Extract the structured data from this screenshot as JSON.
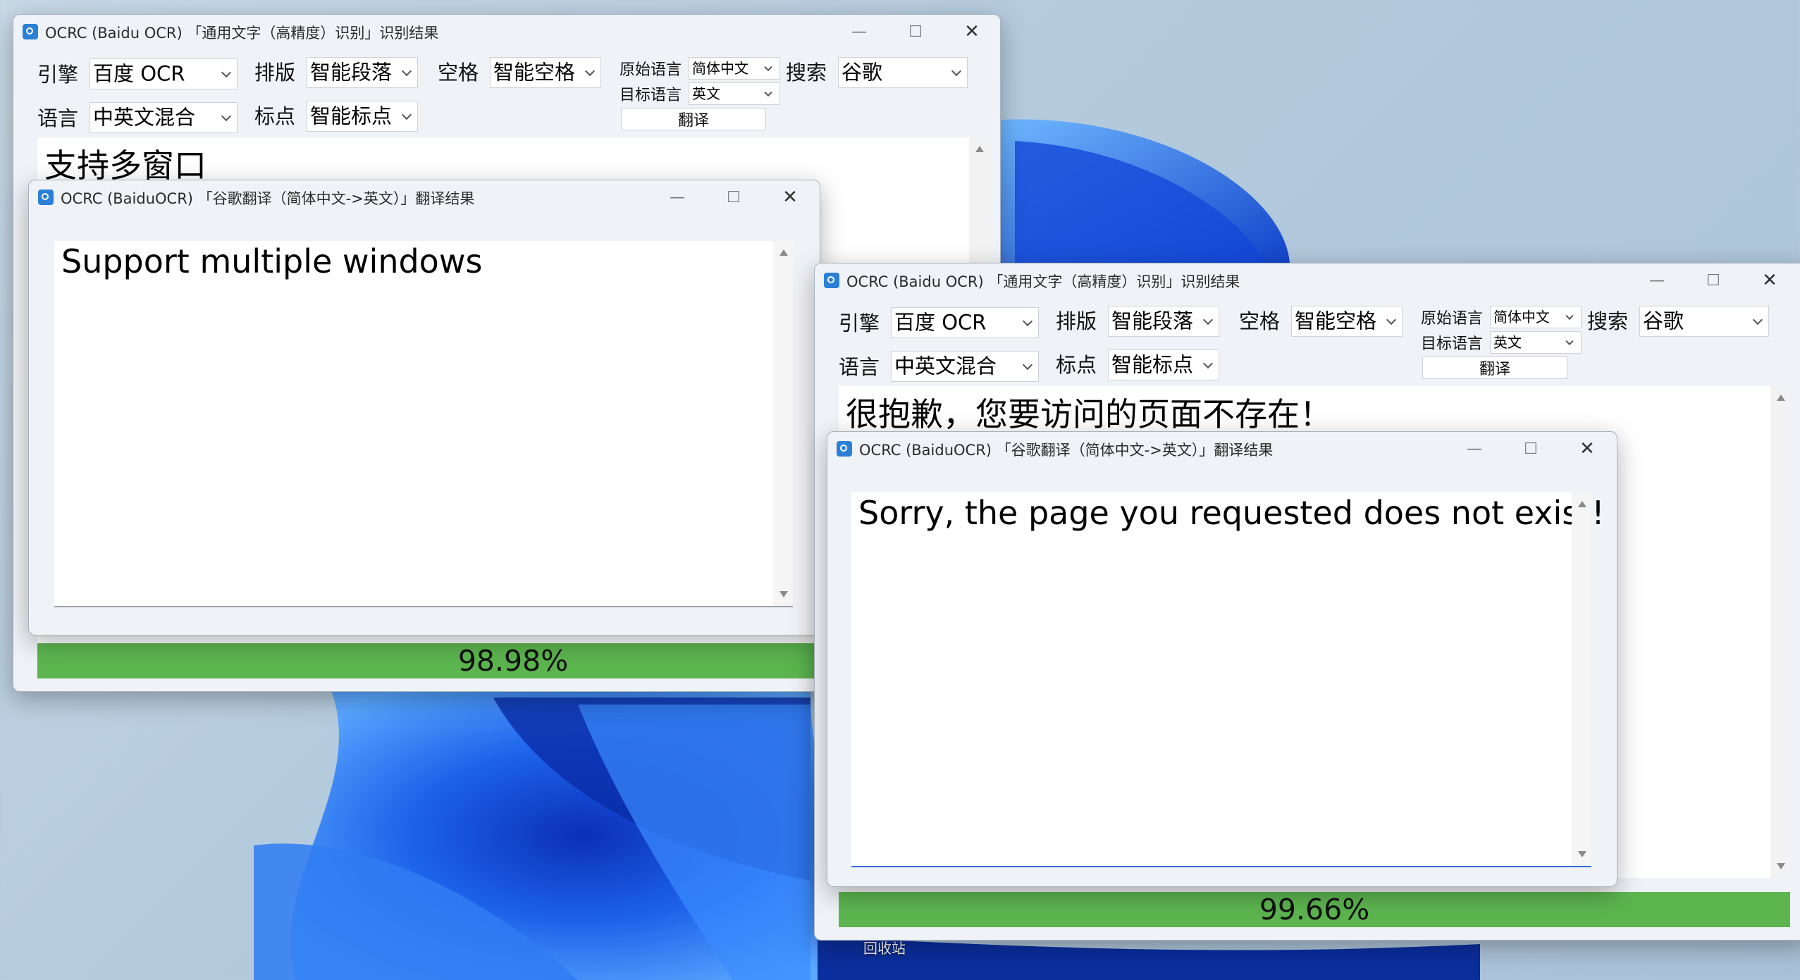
{
  "desktop": {
    "recycle_bin_label": "回收站"
  },
  "win1": {
    "title": "OCRC (Baidu OCR) 「通用文字（高精度）识别」识别结果",
    "engine_label": "引擎",
    "engine_value": "百度 OCR",
    "layout_label": "排版",
    "layout_value": "智能段落",
    "space_label": "空格",
    "space_value": "智能空格",
    "src_lang_label": "原始语言",
    "src_lang_value": "简体中文",
    "tgt_lang_label": "目标语言",
    "tgt_lang_value": "英文",
    "translate_button": "翻译",
    "search_label": "搜索",
    "search_value": "谷歌",
    "language_label": "语言",
    "language_value": "中英文混合",
    "punct_label": "标点",
    "punct_value": "智能标点",
    "result_text": "支持多窗口",
    "confidence": "98.98%"
  },
  "win1_trans": {
    "title": "OCRC (BaiduOCR) 「谷歌翻译（简体中文->英文）」翻译结果",
    "text": "Support multiple windows"
  },
  "win2": {
    "title": "OCRC (Baidu OCR) 「通用文字（高精度）识别」识别结果",
    "engine_label": "引擎",
    "engine_value": "百度 OCR",
    "layout_label": "排版",
    "layout_value": "智能段落",
    "space_label": "空格",
    "space_value": "智能空格",
    "src_lang_label": "原始语言",
    "src_lang_value": "简体中文",
    "tgt_lang_label": "目标语言",
    "tgt_lang_value": "英文",
    "translate_button": "翻译",
    "search_label": "搜索",
    "search_value": "谷歌",
    "language_label": "语言",
    "language_value": "中英文混合",
    "punct_label": "标点",
    "punct_value": "智能标点",
    "result_text": "很抱歉，您要访问的页面不存在！",
    "confidence": "99.66%"
  },
  "win2_trans": {
    "title": "OCRC (BaiduOCR) 「谷歌翻译（简体中文->英文）」翻译结果",
    "text": "Sorry, the page you requested does not exist!"
  },
  "colors": {
    "progress": "#5cb54f",
    "wallpaper_blue": "#1a5fe0"
  }
}
